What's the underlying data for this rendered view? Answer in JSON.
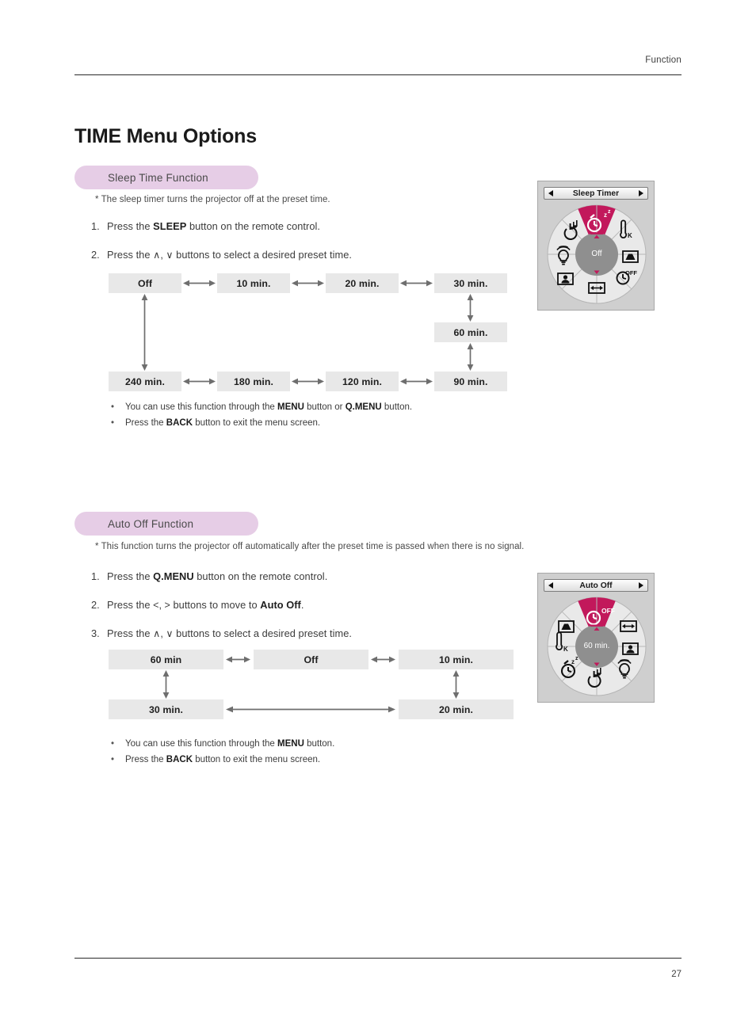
{
  "header": {
    "running_head": "Function"
  },
  "page_title": "TIME Menu Options",
  "footer": {
    "page_number": "27"
  },
  "colors": {
    "pill_bg": "#e6cde6",
    "box_bg": "#e8e8e8",
    "arrow": "#6e6e6e",
    "osd_highlight": "#c2185b",
    "osd_panel_bg": "#cfcfcf",
    "osd_wheel_bg": "#e9e9e9",
    "osd_hub": "#8f8f8f"
  },
  "sections": [
    {
      "id": "sleep-time",
      "pill_label": "Sleep Time Function",
      "note": "* The sleep timer turns the projector off at the preset time.",
      "steps": [
        {
          "num": "1.",
          "pre": "Press the ",
          "bold": "SLEEP",
          "post": " button on the remote control."
        },
        {
          "num": "2.",
          "pre": "Press the ",
          "bold": "",
          "post": "",
          "symbols": "∧, ∨",
          "tail": " buttons to select a desired preset time."
        }
      ],
      "bullets": [
        {
          "parts": [
            "You can use this function through the ",
            "MENU",
            " button or ",
            "Q.MENU",
            " button."
          ]
        },
        {
          "parts": [
            "Press the ",
            "BACK",
            " button to exit the menu screen."
          ]
        }
      ],
      "flow": {
        "top_row": [
          "Off",
          "10 min.",
          "20 min.",
          "30 min."
        ],
        "bottom_row": [
          "240 min.",
          "180 min.",
          "120 min.",
          "90 min."
        ],
        "side_box": "60 min."
      },
      "osd": {
        "title": "Sleep Timer",
        "center_value": "Off",
        "selected_icon": "sleep-timer-icon",
        "segments": [
          "sleep-timer-icon",
          "color-temp-icon",
          "keystone-icon",
          "auto-off-icon",
          "aspect-ratio-icon",
          "picture-mode-icon",
          "lamp-mode-icon",
          "sound-mode-icon"
        ]
      }
    },
    {
      "id": "auto-off",
      "pill_label": "Auto Off Function",
      "note": "* This function turns the projector off automatically after the preset time is passed when there is no signal.",
      "steps": [
        {
          "num": "1.",
          "pre": "Press the ",
          "bold": "Q.MENU",
          "post": " button on the remote control."
        },
        {
          "num": "2.",
          "pre": "Press the ",
          "symbols": "<, >",
          "mid": " buttons to move to ",
          "bold": "Auto Off",
          "post": "."
        },
        {
          "num": "3.",
          "pre": "Press the ",
          "symbols": "∧, ∨",
          "tail": " buttons to select a desired preset time."
        }
      ],
      "bullets": [
        {
          "parts": [
            "You can use this function through the ",
            "MENU",
            " button."
          ]
        },
        {
          "parts": [
            "Press the ",
            "BACK",
            " button to exit the menu screen."
          ]
        }
      ],
      "flow": {
        "top_row": [
          "60 min",
          "Off",
          "10 min."
        ],
        "bottom_row": [
          "30 min.",
          "20 min."
        ]
      },
      "osd": {
        "title": "Auto Off",
        "center_value": "60 min.",
        "selected_icon": "auto-off-icon",
        "segments": [
          "auto-off-icon",
          "aspect-ratio-icon",
          "picture-mode-icon",
          "lamp-mode-icon",
          "sound-mode-icon",
          "sleep-timer-icon",
          "color-temp-icon",
          "keystone-icon"
        ]
      }
    }
  ]
}
